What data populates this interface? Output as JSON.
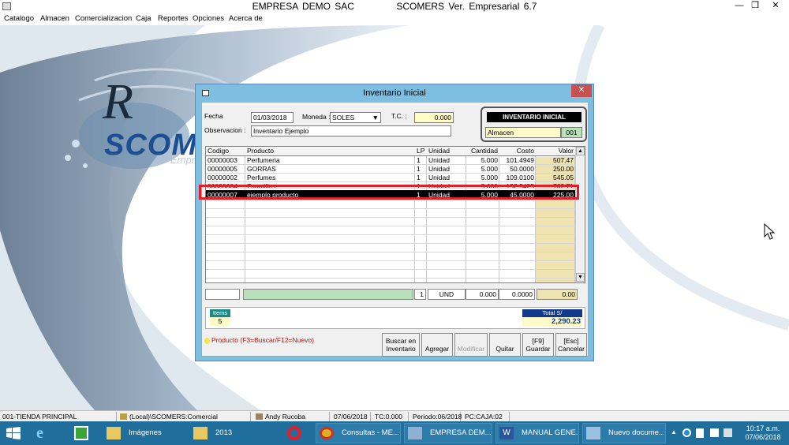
{
  "app": {
    "company": "EMPRESA DEMO SAC",
    "product": "SCOMERS Ver. Empresarial  6.7"
  },
  "window_controls": {
    "minimize": "—",
    "restore": "❐",
    "close": "✕"
  },
  "menu": [
    "Catalogo",
    "Almacen",
    "Comercializacion",
    "Caja",
    "Reportes",
    "Opciones",
    "Acerca de"
  ],
  "logo": {
    "text": "SCOMER",
    "sub": "Empre"
  },
  "dialog": {
    "title": "Inventario Inicial",
    "close": "✕",
    "fecha_label": "Fecha",
    "fecha": "01/03/2018",
    "moneda_label": "Moneda :",
    "moneda": "SOLES",
    "tc_label": "T.C. :",
    "tc": "0.000",
    "obs_label": "Observacion :",
    "obs": "Inventario Ejemplo",
    "ii_title": "INVENTARIO INICIAL",
    "almacen": "Almacen",
    "almacen_code": "001",
    "headers": [
      "Codigo",
      "Producto",
      "LP",
      "Unidad",
      "Cantidad",
      "Costo",
      "Valor"
    ],
    "rows": [
      {
        "codigo": "00000003",
        "producto": "Perfumeria",
        "lp": "1",
        "unidad": "Unidad",
        "cantidad": "5.000",
        "costo": "101.4949",
        "valor": "507.47"
      },
      {
        "codigo": "00000005",
        "producto": "GORRAS",
        "lp": "1",
        "unidad": "Unidad",
        "cantidad": "5.000",
        "costo": "50.0000",
        "valor": "250.00"
      },
      {
        "codigo": "00000002",
        "producto": "Perfumes",
        "lp": "1",
        "unidad": "Unidad",
        "cantidad": "5.000",
        "costo": "109.0100",
        "valor": "545.05"
      },
      {
        "codigo": "00000004",
        "producto": "Zapatillas",
        "lp": "1",
        "unidad": "Unidad",
        "cantidad": "5.000",
        "costo": "152.5425",
        "valor": "762.71"
      },
      {
        "codigo": "00000007",
        "producto": "ejemplo producto",
        "lp": "1",
        "unidad": "Unidad",
        "cantidad": "5.000",
        "costo": "45.0000",
        "valor": "225.00",
        "selected": true
      }
    ],
    "entry": {
      "lp": "1",
      "unidad": "UND",
      "cantidad": "0.000",
      "costo": "0.0000",
      "valor": "0.00"
    },
    "items_label": "Items",
    "items_count": "5",
    "total_label": "Total S/",
    "total": "2,290.23",
    "hint": "Producto (F3=Buscar/F12=Nuevo)",
    "buttons": [
      {
        "line1": "Buscar en",
        "line2": "Inventario",
        "enabled": true
      },
      {
        "line1": "",
        "line2": "Agregar",
        "enabled": true
      },
      {
        "line1": "",
        "line2": "Modificar",
        "enabled": false
      },
      {
        "line1": "",
        "line2": "Quitar",
        "enabled": true
      },
      {
        "line1": "[F9]",
        "line2": "Guardar",
        "enabled": true
      },
      {
        "line1": "[Esc]",
        "line2": "Cancelar",
        "enabled": true
      }
    ]
  },
  "status": [
    "001-TIENDA PRINCIPAL",
    "(Local)\\SCOMERS:Comercial",
    "Andy Rucoba",
    "07/06/2018",
    "TC:0.000",
    "Periodo:06/2018",
    "PC:CAJA:02"
  ],
  "taskbar": [
    "Imágenes",
    "2013",
    "Consultas - ME...",
    "EMPRESA DEM...",
    "MANUAL GENE...",
    "Nuevo docume..."
  ],
  "clock": {
    "time": "10:17 a.m.",
    "date": "07/06/2018"
  }
}
